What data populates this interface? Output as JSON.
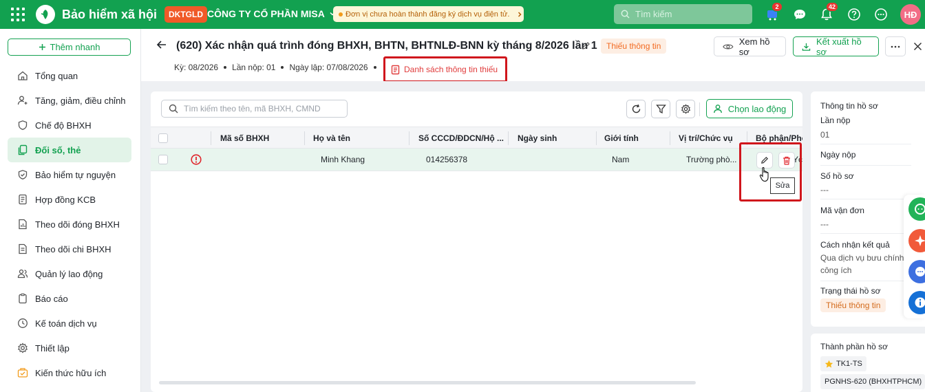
{
  "topbar": {
    "app_title": "Bảo hiểm xã hội",
    "company_code": "DKTGLD",
    "company_name": "CÔNG TY CỔ PHẦN MISA",
    "warning_text": "Đơn vị chưa hoàn thành đăng ký dịch vụ điện tử.",
    "search_placeholder": "Tìm kiếm",
    "cart_badge": "2",
    "notif_badge": "42",
    "avatar_initials": "HĐ"
  },
  "sidebar": {
    "quick_add": "Thêm nhanh",
    "items": [
      {
        "label": "Tổng quan"
      },
      {
        "label": "Tăng, giảm, điều chỉnh"
      },
      {
        "label": "Chế độ BHXH"
      },
      {
        "label": "Đối số, thẻ"
      },
      {
        "label": "Bảo hiểm tự nguyện"
      },
      {
        "label": "Hợp đồng KCB"
      },
      {
        "label": "Theo dõi đóng BHXH"
      },
      {
        "label": "Theo dõi chi BHXH"
      },
      {
        "label": "Quản lý lao động"
      },
      {
        "label": "Báo cáo"
      },
      {
        "label": "Kế toán dịch vụ"
      },
      {
        "label": "Thiết lập"
      },
      {
        "label": "Kiến thức hữu ích"
      }
    ]
  },
  "header": {
    "title": "(620) Xác nhận quá trình đóng BHXH, BHTN, BHTNLĐ-BNN kỳ tháng 8/2026 lần 1",
    "status": "Thiếu thông tin",
    "view_button": "Xem hồ sơ",
    "export_button": "Kết xuất hồ sơ",
    "period": "Kỳ: 08/2026",
    "submission": "Lần nộp: 01",
    "created_date": "Ngày lập: 07/08/2026",
    "missing_list_link": "Danh sách thông tin thiếu"
  },
  "table": {
    "search_placeholder": "Tìm kiếm theo tên, mã BHXH, CMND",
    "choose_worker_button": "Chọn lao động",
    "columns": [
      "Mã số BHXH",
      "Họ và tên",
      "Số CCCD/ĐDCN/Hộ ...",
      "Ngày sinh",
      "Giới tính",
      "Vị trí/Chức vụ",
      "Bộ phận/Phò"
    ],
    "rows": [
      {
        "bhxh": "",
        "name": "Minh Khang",
        "id": "014256378",
        "dob": "",
        "gender": "Nam",
        "position": "Trường phò...",
        "dept": "ON Yc"
      }
    ],
    "edit_tooltip": "Sửa"
  },
  "info_panel": {
    "heading": "Thông tin hồ sơ",
    "submission_label": "Lần nộp",
    "submission_value": "01",
    "submit_date_label": "Ngày nộp",
    "file_no_label": "Số hồ sơ",
    "file_no_value": "---",
    "tracking_label": "Mã vận đơn",
    "tracking_value": "---",
    "receive_label": "Cách nhận kết quả",
    "receive_value": "Qua dịch vụ bưu chính công ích",
    "status_label": "Trạng thái hồ sơ",
    "status_value": "Thiếu thông tin"
  },
  "components_panel": {
    "heading": "Thành phần hồ sơ",
    "chip1": "TK1-TS",
    "chip2": "PGNHS-620 (BHXHTPHCM)"
  }
}
